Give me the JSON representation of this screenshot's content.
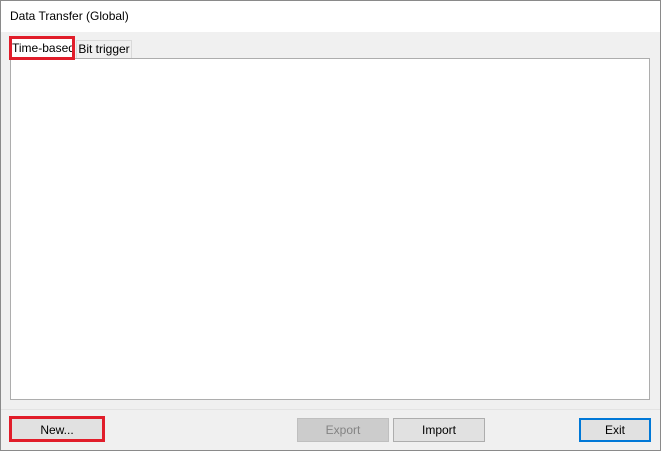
{
  "window": {
    "title": "Data Transfer (Global)"
  },
  "tabs": [
    {
      "label": "Time-based",
      "active": true
    },
    {
      "label": "Bit trigger",
      "active": false
    }
  ],
  "buttons": {
    "new_label": "New...",
    "export_label": "Export",
    "import_label": "Import",
    "exit_label": "Exit"
  },
  "colors": {
    "highlight": "#e11d2a",
    "focus_border": "#0078d7",
    "window_bg": "#f0f0f0"
  }
}
